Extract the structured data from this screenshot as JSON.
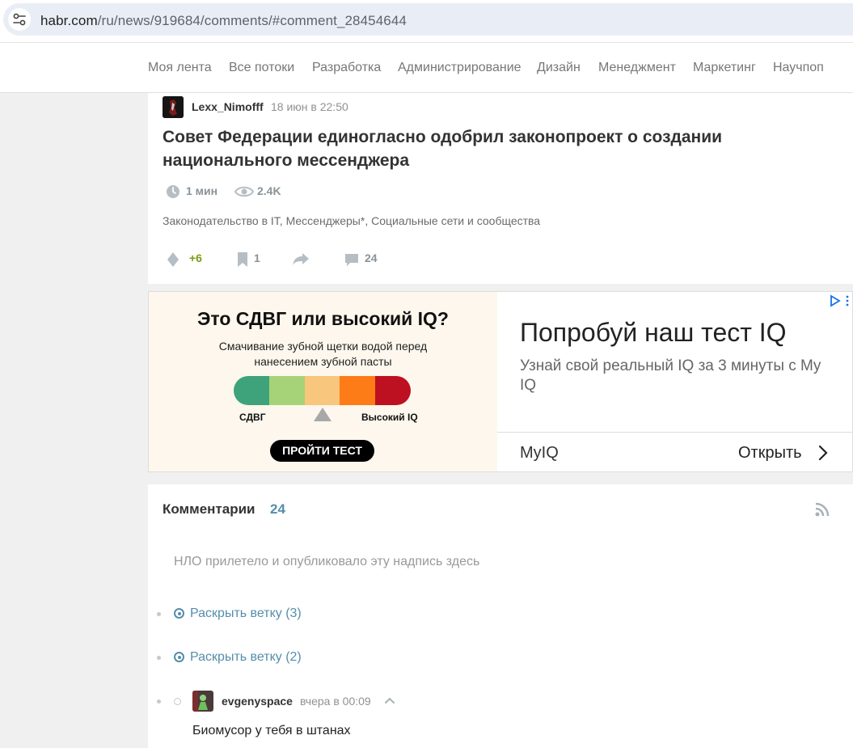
{
  "browser": {
    "url_host": "habr.com",
    "url_path": "/ru/news/919684/comments/#comment_28454644"
  },
  "nav": {
    "items": [
      "Моя лента",
      "Все потоки",
      "Разработка",
      "Администрирование",
      "Дизайн",
      "Менеджмент",
      "Маркетинг",
      "Научпоп"
    ]
  },
  "article": {
    "author": "Lexx_Nimofff",
    "date": "18 июн в 22:50",
    "title": "Совет Федерации единогласно одобрил законопроект о создании национального мессенджера",
    "read_time": "1 мин",
    "views": "2.4K",
    "hubs": [
      "Законодательство в IT",
      "Мессенджеры*",
      "Социальные сети и сообщества"
    ],
    "rating": "+6",
    "bookmarks": "1",
    "comments_count": "24",
    "rating_color": "#7b9d14"
  },
  "ad": {
    "headline": "Это СДВГ или высокий IQ?",
    "subtext": "Смачивание зубной щетки водой перед нанесением зубной пасты",
    "scale_colors": [
      "#3ea37a",
      "#a6d377",
      "#f8c67c",
      "#fd7c18",
      "#bd1020"
    ],
    "label_left": "СДВГ",
    "label_right": "Высокий IQ",
    "cta": "ПРОЙТИ ТЕСТ",
    "title": "Попробуй наш тест IQ",
    "description": "Узнай свой реальный IQ за 3 минуты с My IQ",
    "brand": "MyIQ",
    "open_label": "Открыть"
  },
  "comments": {
    "heading": "Комментарии",
    "count": "24",
    "ufo_text": "НЛО прилетело и опубликовало эту надпись здесь",
    "branches": [
      "Раскрыть ветку (3)",
      "Раскрыть ветку (2)"
    ],
    "comment": {
      "author": "evgenyspace",
      "date": "вчера в 00:09",
      "text": "Биомусор у тебя в штанах"
    },
    "link_color": "#548eaa"
  }
}
